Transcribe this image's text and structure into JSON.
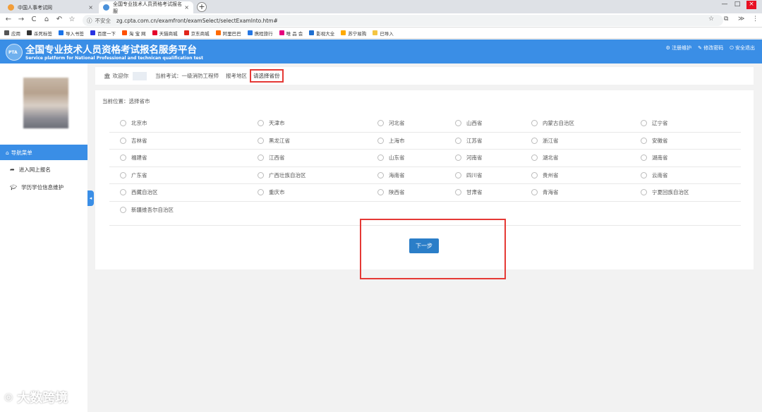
{
  "browser": {
    "tabs": [
      {
        "title": "中国人事考试网",
        "close": "×"
      },
      {
        "title": "全国专业技术人员资格考试报名服",
        "close": "×"
      }
    ],
    "new_tab": "+",
    "window_controls": [
      "—",
      "□",
      "×"
    ],
    "nav": {
      "back": "←",
      "forward": "→",
      "reload": "C",
      "home": "⌂",
      "undo": "↶",
      "star": "☆"
    },
    "not_secure": "不安全",
    "url": "zg.cpta.com.cn/examfront/examSelect/selectExamInto.htm#",
    "right_icons": [
      "☆",
      "⧉",
      "≫",
      "⋮"
    ],
    "bookmarks": [
      {
        "label": "应用",
        "color": "#555555"
      },
      {
        "label": "杀死标签",
        "color": "#333333"
      },
      {
        "label": "导入书签",
        "color": "#1a73e8"
      },
      {
        "label": "百度一下",
        "color": "#2932e1"
      },
      {
        "label": "淘 宝 网",
        "color": "#ff5000"
      },
      {
        "label": "天猫商城",
        "color": "#e4002b"
      },
      {
        "label": "京东商城",
        "color": "#e1251b"
      },
      {
        "label": "阿里巴巴",
        "color": "#ff6a00"
      },
      {
        "label": "携程旅行",
        "color": "#2577e3"
      },
      {
        "label": "唯 品 会",
        "color": "#e6007e"
      },
      {
        "label": "影视大全",
        "color": "#1f6fd0"
      },
      {
        "label": "苏宁易购",
        "color": "#ffaa00"
      },
      {
        "label": "已导入",
        "color": "#f4c542"
      }
    ]
  },
  "header": {
    "logo_text": "PTA",
    "title": "全国专业技术人员资格考试报名服务平台",
    "subtitle": "Service platform for National Professional and technican qualification test",
    "links": [
      "注册维护",
      "修改密码",
      "安全退出"
    ]
  },
  "sidebar": {
    "nav_head": "导航菜单",
    "items": [
      "进入网上报名",
      "学历学位信息维护"
    ],
    "collapse": "◂"
  },
  "topinfo": {
    "welcome": "欢迎你",
    "current_exam": "当前考试：一级消防工程师",
    "region_label": "报考地区",
    "select_province": "请选择省份"
  },
  "panel": {
    "location": "当前位置：选择省市",
    "rows": [
      [
        "北京市",
        "天津市",
        "河北省",
        "山西省",
        "内蒙古自治区",
        "辽宁省"
      ],
      [
        "吉林省",
        "黑龙江省",
        "上海市",
        "江苏省",
        "浙江省",
        "安徽省"
      ],
      [
        "福建省",
        "江西省",
        "山东省",
        "河南省",
        "湖北省",
        "湖南省"
      ],
      [
        "广东省",
        "广西壮族自治区",
        "海南省",
        "四川省",
        "贵州省",
        "云南省"
      ],
      [
        "西藏自治区",
        "重庆市",
        "陕西省",
        "甘肃省",
        "青海省",
        "宁夏回族自治区"
      ],
      [
        "新疆维吾尔自治区"
      ]
    ],
    "next_button": "下一步"
  },
  "watermark": "大数跨境"
}
